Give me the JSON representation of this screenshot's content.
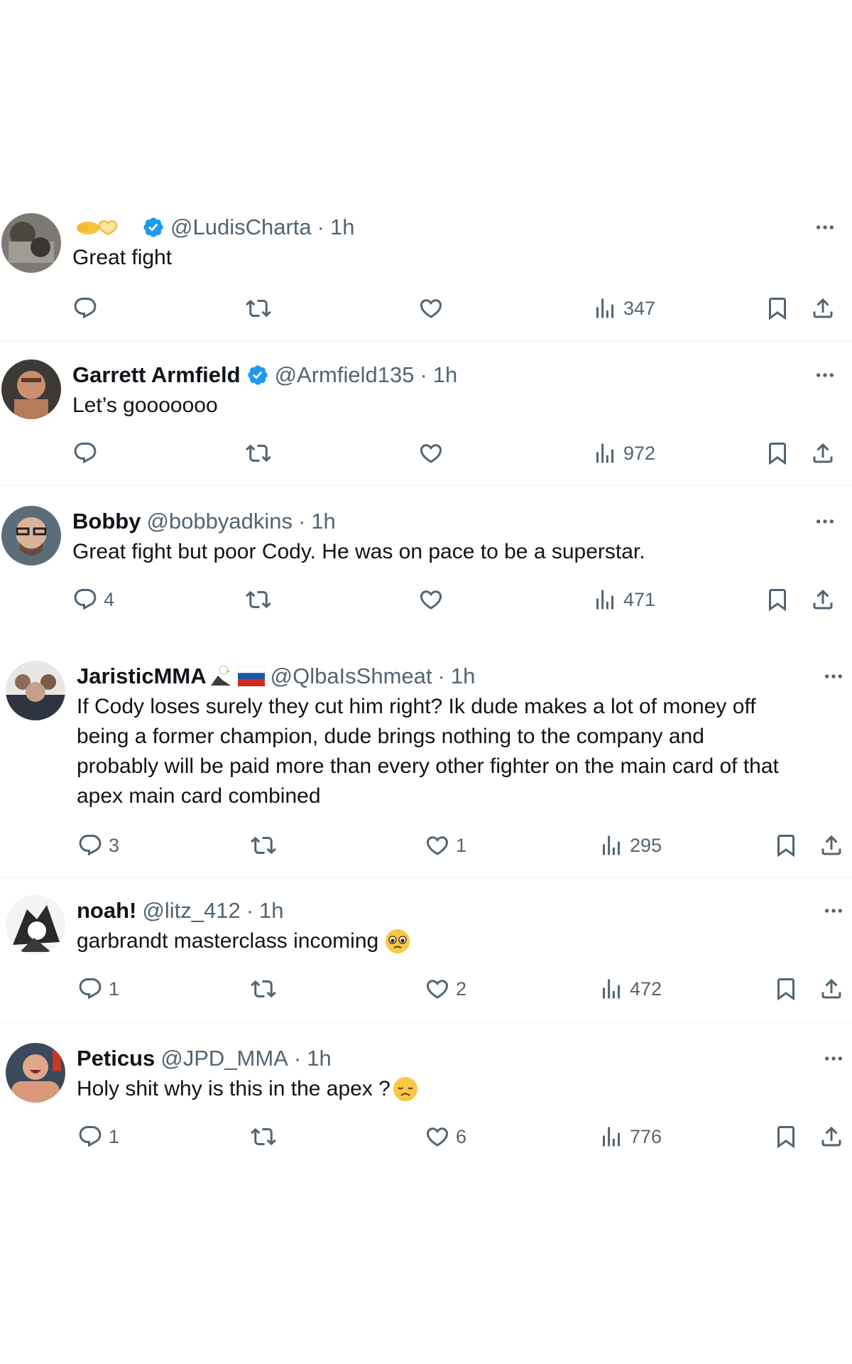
{
  "tweets": [
    {
      "name": "",
      "handle": "@LudisCharta",
      "time": "1h",
      "text": "Great fight",
      "replies": "",
      "likes": "",
      "views": "347"
    },
    {
      "name": "Garrett Armfield",
      "handle": "@Armfield135",
      "time": "1h",
      "text": "Let’s gooooooo",
      "replies": "",
      "likes": "",
      "views": "972"
    },
    {
      "name": "Bobby",
      "handle": "@bobbyadkins",
      "time": "1h",
      "text": "Great fight but poor Cody. He was on pace to be a superstar.",
      "replies": "4",
      "likes": "",
      "views": "471"
    },
    {
      "name": "JaristicMMA",
      "handle": "@QlbaIsShmeat",
      "time": "1h",
      "text_lines": [
        "If Cody loses surely they cut him right? Ik dude makes a lot of money off",
        "being a former champion, dude brings nothing to the company and",
        "probably will be paid more than every other fighter on the main card of that",
        "apex main card combined"
      ],
      "replies": "3",
      "likes": "1",
      "views": "295"
    },
    {
      "name": "noah!",
      "handle": "@litz_412",
      "time": "1h",
      "text": "garbrandt masterclass incoming",
      "replies": "1",
      "likes": "2",
      "views": "472"
    },
    {
      "name": "Peticus",
      "handle": "@JPD_MMA",
      "time": "1h",
      "text": "Holy shit why is this in the apex ?",
      "replies": "1",
      "likes": "6",
      "views": "776"
    }
  ],
  "separator": "·",
  "icons": {
    "reply": "reply-icon",
    "retweet": "retweet-icon",
    "like": "heart-icon",
    "views": "views-icon",
    "bookmark": "bookmark-icon",
    "share": "share-icon",
    "more": "more-icon",
    "verified": "verified-badge-icon"
  },
  "colors": {
    "text": "#0f1419",
    "secondary": "#536471",
    "verified": "#1d9bf0",
    "divider": "#eff3f4"
  }
}
